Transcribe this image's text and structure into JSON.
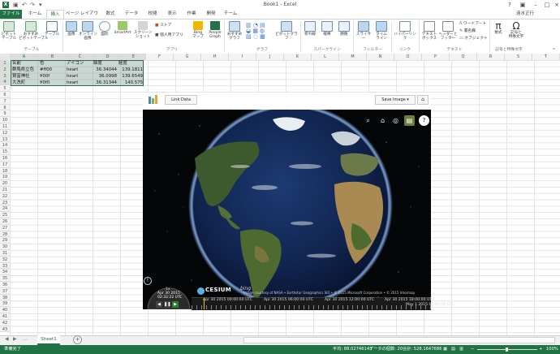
{
  "window": {
    "title": "Book1 - Excel",
    "user": "遠水正行"
  },
  "qat_icons": [
    "save-icon",
    "undo-icon",
    "redo-icon"
  ],
  "tabs": [
    {
      "id": "file",
      "label": "ファイル"
    },
    {
      "id": "home",
      "label": "ホーム"
    },
    {
      "id": "insert",
      "label": "挿入"
    },
    {
      "id": "layout",
      "label": "ページ レイアウト"
    },
    {
      "id": "formulas",
      "label": "数式"
    },
    {
      "id": "data",
      "label": "データ"
    },
    {
      "id": "review",
      "label": "校閲"
    },
    {
      "id": "view",
      "label": "表示"
    },
    {
      "id": "develop",
      "label": "作業"
    },
    {
      "id": "addins",
      "label": "開発"
    },
    {
      "id": "team",
      "label": "チーム"
    }
  ],
  "ribbon": {
    "pivot": "ピボット\nテーブル",
    "rec_pivot": "おすすめ\nピボットテーブル",
    "table": "テーブル",
    "picture": "画像",
    "online_picture": "オンライン\n画像",
    "shapes": "図形",
    "smartart": "SmartArt",
    "screenshot": "スクリーン\nショット",
    "store": "ストア",
    "myapps": "個人用アプリ",
    "bing": "Bing\nマップ",
    "people": "People\nGraph",
    "rec_charts": "おすすめ\nグラフ",
    "pivotchart": "ピボットグラフ",
    "line": "折れ線",
    "column": "縦棒",
    "winloss": "勝敗",
    "slicer": "スライサー",
    "timeline": "タイム\nライン",
    "hyperlink": "ハイパーリンク",
    "textbox": "テキスト\nボックス",
    "header_footer": "ヘッダーと\nフッター",
    "wordart": "ワードアート",
    "signature": "署名欄",
    "object": "オブジェクト",
    "equation": "数式",
    "symbol": "記号と\n特殊文字",
    "groups": {
      "tables": "テーブル",
      "apps": "アプリ",
      "charts": "グラフ",
      "sparklines": "スパークライン",
      "filters": "フィルター",
      "links": "リンク",
      "text": "テキスト",
      "symbols": "記号と特殊文字"
    }
  },
  "formula_bar": {
    "fx": "fx"
  },
  "columns": [
    "A",
    "B",
    "C",
    "D",
    "E",
    "F",
    "G",
    "H",
    "I",
    "J",
    "K",
    "L",
    "M",
    "N",
    "O",
    "P",
    "Q",
    "R",
    "S",
    "T"
  ],
  "rows": [
    "1",
    "2",
    "3",
    "4",
    "5",
    "6",
    "7",
    "8",
    "9",
    "10",
    "11",
    "12",
    "13",
    "14",
    "15",
    "16",
    "17",
    "18",
    "19",
    "20",
    "21",
    "22",
    "23",
    "24",
    "25",
    "26",
    "27",
    "28",
    "29",
    "30",
    "31",
    "32",
    "33",
    "34",
    "35",
    "36",
    "37",
    "38",
    "39",
    "40",
    "41",
    "42",
    "43"
  ],
  "table": {
    "headers": [
      "名前",
      "色",
      "アイコン",
      "緯度",
      "経度"
    ],
    "rows": [
      [
        "群馬県立色",
        "#ff00",
        "heart",
        "36.34044",
        "139.1811"
      ],
      [
        "賢富神社",
        "¥00f",
        "heart",
        "36.0998",
        "139.6549"
      ],
      [
        "大洗町",
        "¥0f0",
        "heart",
        "36.31344",
        "140.575"
      ]
    ]
  },
  "app": {
    "link_data": "Link Data",
    "save_image": "Save Image ▾",
    "home": "⌂",
    "tools": [
      "search-icon",
      "home-icon",
      "globe-icon",
      "layers-icon",
      "help-icon"
    ],
    "clock": {
      "date": "Apr 30 2015",
      "time": "02:32:22 UTC",
      "speed": "1x"
    },
    "cesium": "CESIUM",
    "bing": "bing",
    "credit": "Image courtesy of NASA • Earthstar Geographics SIO • © 2015 Microsoft Corporation • © 2015 Intermap",
    "timeline_labels": [
      "Apr 30 2015 00:00:00 UTC",
      "Apr 30 2015 06:00:00 UTC",
      "Apr 30 2015 12:00:00 UTC",
      "Apr 30 2015 18:00:00 UTC",
      "May 1 2015 00:00:00 UTC"
    ]
  },
  "sheets": [
    "Sheet1"
  ],
  "status": {
    "ready": "準備完了",
    "average": "平均: 88.02746143",
    "count": "データの個数: 20",
    "sum": "合計: 528.1647686",
    "zoom": "100%"
  }
}
